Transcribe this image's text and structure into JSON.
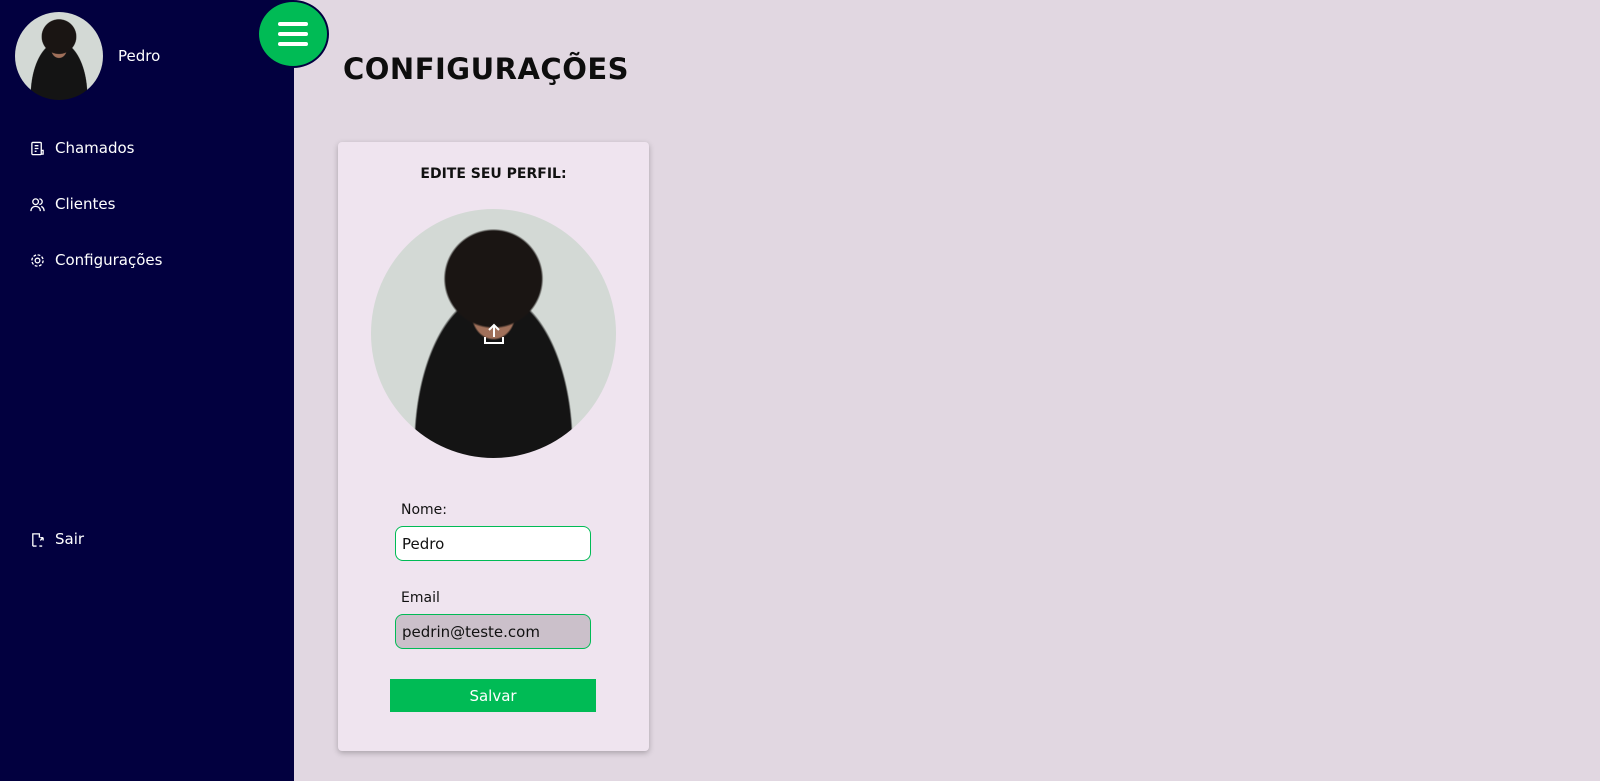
{
  "sidebar": {
    "user_name": "Pedro",
    "items": [
      {
        "label": "Chamados",
        "icon": "document-icon"
      },
      {
        "label": "Clientes",
        "icon": "users-icon"
      },
      {
        "label": "Configurações",
        "icon": "gear-icon"
      }
    ],
    "logout": "Sair"
  },
  "header": {
    "title": "CONFIGURAÇÕES"
  },
  "profile": {
    "title": "EDITE SEU PERFIL:",
    "name_label": "Nome:",
    "name_value": "Pedro",
    "email_label": "Email",
    "email_value": "pedrin@teste.com",
    "save_label": "Salvar"
  },
  "colors": {
    "sidebar": "#02003f",
    "accent": "#00bb55",
    "background": "#e1d7e1"
  }
}
